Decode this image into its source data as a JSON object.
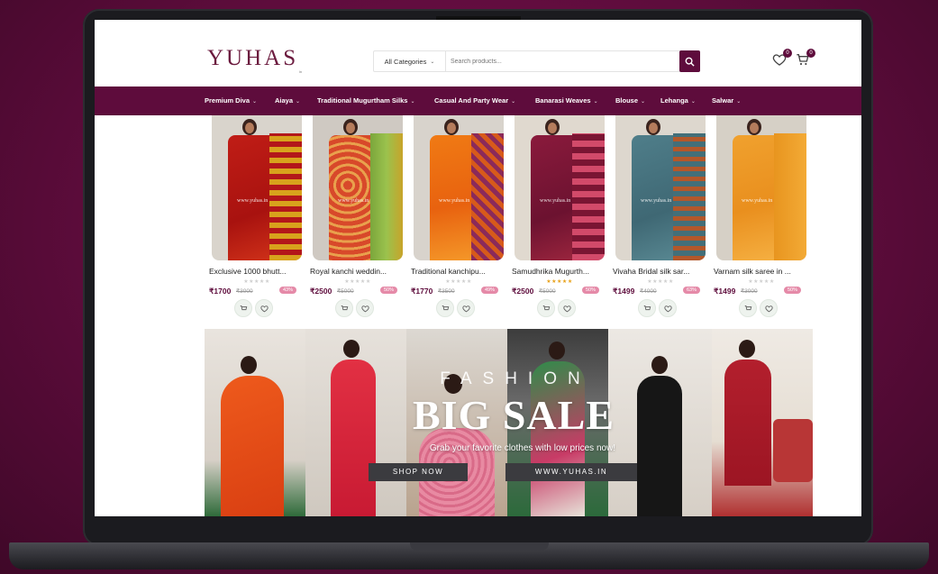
{
  "header": {
    "logo": "YUHAS",
    "logo_sub": "in",
    "category_select": "All Categories",
    "search_placeholder": "Search products...",
    "wishlist_count": "0",
    "cart_count": "0"
  },
  "nav": {
    "items": [
      {
        "label": "Premium Diva"
      },
      {
        "label": "Aiaya"
      },
      {
        "label": "Traditional Mugurtham Silks"
      },
      {
        "label": "Casual And Party Wear"
      },
      {
        "label": "Banarasi Weaves"
      },
      {
        "label": "Blouse"
      },
      {
        "label": "Lehanga"
      },
      {
        "label": "Salwar"
      }
    ]
  },
  "products": [
    {
      "name": "Exclusive 1000 bhutt...",
      "price": "₹1700",
      "old_price": "₹3000",
      "discount": "43%",
      "rated": false,
      "watermark": "www.yuhas.in"
    },
    {
      "name": "Royal kanchi weddin...",
      "price": "₹2500",
      "old_price": "₹5000",
      "discount": "50%",
      "rated": false,
      "watermark": "www.yuhas.in"
    },
    {
      "name": "Traditional kanchipu...",
      "price": "₹1770",
      "old_price": "₹3500",
      "discount": "49%",
      "rated": false,
      "watermark": "www.yuhas.in"
    },
    {
      "name": "Samudhrika Mugurth...",
      "price": "₹2500",
      "old_price": "₹5000",
      "discount": "50%",
      "rated": true,
      "watermark": "www.yuhas.in"
    },
    {
      "name": "Vivaha Bridal silk sar...",
      "price": "₹1499",
      "old_price": "₹4000",
      "discount": "63%",
      "rated": false,
      "watermark": "www.yuhas.in"
    },
    {
      "name": "Varnam silk saree in ...",
      "price": "₹1499",
      "old_price": "₹3000",
      "discount": "50%",
      "rated": false,
      "watermark": "www.yuhas.in"
    }
  ],
  "banner": {
    "fashion": "FASHION",
    "headline": "BIG SALE",
    "tagline": "Grab your favorite clothes with low prices now!",
    "shop_now": "SHOP NOW",
    "site": "WWW.YUHAS.IN"
  },
  "colors": {
    "brand": "#5e0c3c",
    "background": "#6b0f45",
    "rating_star": "#e8a21b",
    "discount_badge": "#e58aa8"
  },
  "icons": [
    "search-icon",
    "heart-icon",
    "cart-icon",
    "chevron-down-icon",
    "star-icon"
  ]
}
